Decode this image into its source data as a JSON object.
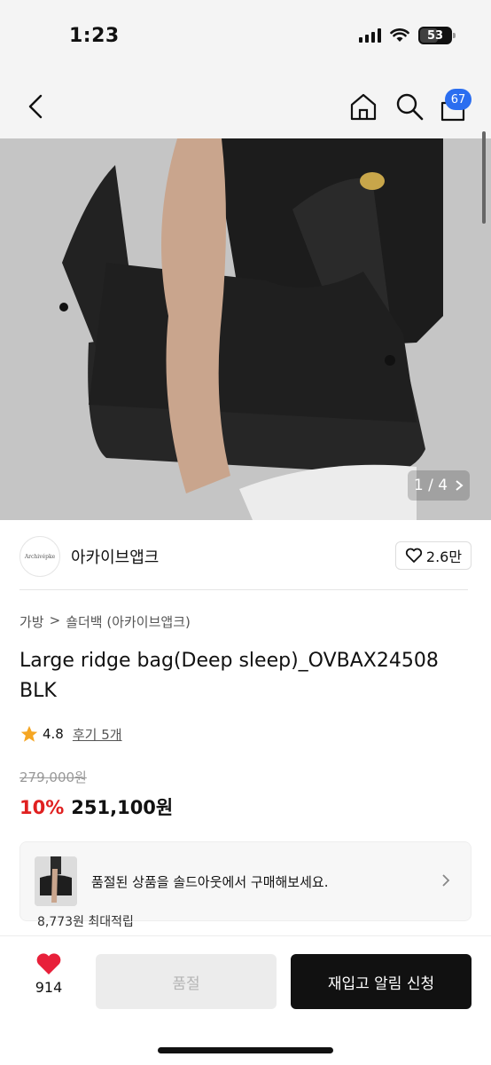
{
  "status_bar": {
    "time": "1:23",
    "battery": "53"
  },
  "nav": {
    "cart_count": "67"
  },
  "hero": {
    "counter": "1 / 4"
  },
  "brand": {
    "logo_text": "Archivépke",
    "name": "아카이브앱크",
    "likes": "2.6만"
  },
  "breadcrumb": {
    "category": "가방",
    "separator": ">",
    "subcategory": "숄더백 (아카이브앱크)"
  },
  "product": {
    "title": "Large ridge bag(Deep sleep)_OVBAX24508 BLK",
    "rating": "4.8",
    "reviews": "후기 5개",
    "original_price": "279,000원",
    "discount": "10%",
    "price": "251,100원"
  },
  "soldout_card": {
    "text": "품절된 상품을 솔드아웃에서 구매해보세요."
  },
  "peek_text": "8,773원 최대적립",
  "bottom": {
    "heart_count": "914",
    "soldout_label": "품절",
    "restock_label": "재입고 알림 신청"
  },
  "colors": {
    "accent_blue": "#2b6ef0",
    "discount_red": "#e02020",
    "heart_red": "#e8203a",
    "star": "#f5a623"
  }
}
